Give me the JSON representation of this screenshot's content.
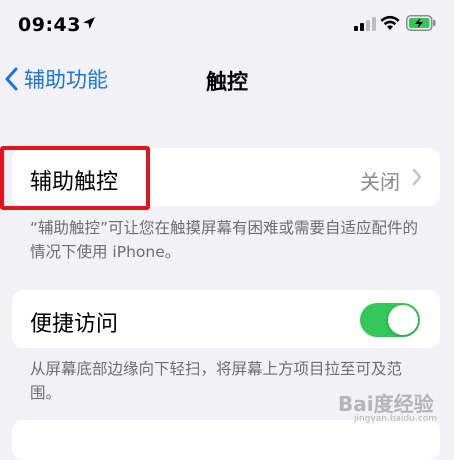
{
  "status_bar": {
    "time": "09:43",
    "icons": [
      "location-arrow-icon",
      "cellular-signal-icon",
      "wifi-icon",
      "battery-charging-icon"
    ]
  },
  "nav": {
    "back_label": "辅助功能",
    "title": "触控"
  },
  "sections": {
    "assistive_touch": {
      "label": "辅助触控",
      "value": "关闭",
      "footnote": "“辅助触控”可让您在触摸屏幕有困难或需要自适应配件的情况下使用 iPhone。"
    },
    "reachability": {
      "label": "便捷访问",
      "toggle_on": true,
      "footnote": "从屏幕底部边缘向下轻扫，将屏幕上方项目拉至可及范围。"
    }
  },
  "colors": {
    "accent": "#1a76d9",
    "toggle_on": "#34c759",
    "highlight": "#e0161e",
    "background": "#f1f1f6"
  },
  "watermark": {
    "text": "Bai度经验",
    "sub": "jingyan.baidu.com"
  }
}
